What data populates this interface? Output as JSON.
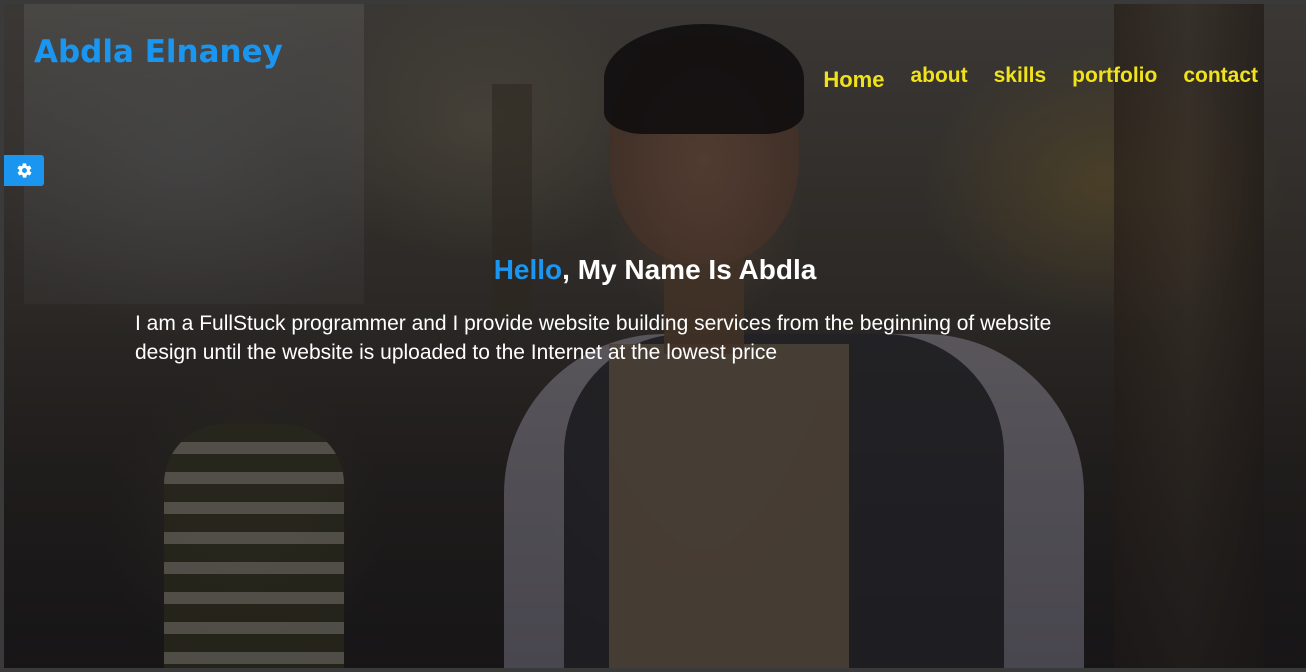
{
  "header": {
    "logo_text": "Abdla Elnaney"
  },
  "nav": {
    "items": [
      {
        "label": "Home"
      },
      {
        "label": "about"
      },
      {
        "label": "skills"
      },
      {
        "label": "portfolio"
      },
      {
        "label": "contact"
      }
    ]
  },
  "settings_button": {
    "icon": "gear-icon"
  },
  "hero": {
    "greeting": "Hello",
    "title_rest": ", My Name Is Abdla",
    "description": "I am a FullStuck programmer and I provide website building services from the beginning of website design until the website is uploaded to the Internet at the lowest price"
  },
  "colors": {
    "accent_blue": "#1a96f0",
    "nav_yellow": "#f0e21c",
    "text_white": "#ffffff"
  }
}
